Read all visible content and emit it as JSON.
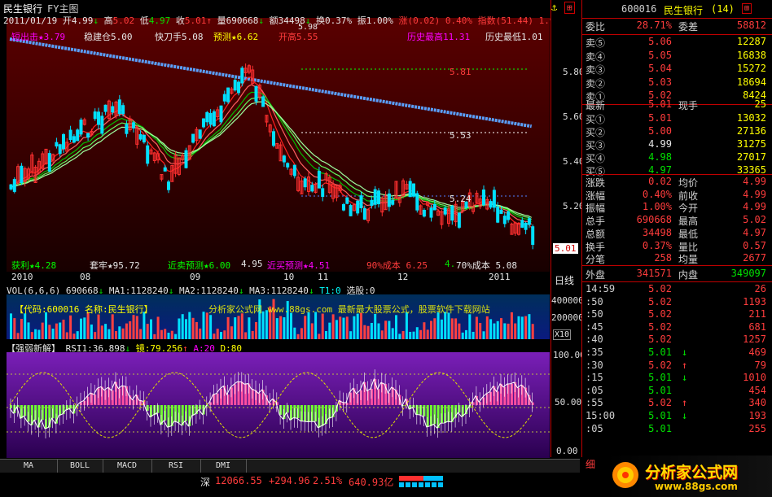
{
  "header": {
    "stock_name": "民生银行",
    "sub_view": "FY主图",
    "date": "2011/01/19",
    "open_label": "开",
    "open": "4.99",
    "high_label": "高",
    "high": "5.02",
    "low_label": "低",
    "low": "4.97",
    "close_label": "收",
    "close": "5.01",
    "volume_label": "量",
    "volume": "690668",
    "amount_label": "额",
    "amount": "34498",
    "turnover_label": "换",
    "turnover": "0.37%",
    "amplitude_label": "振",
    "amplitude": "1.00%",
    "change_label": "涨",
    "change": "(0.02)",
    "change_pct": "0.40%",
    "index_label": "指数",
    "index": "(51.44)",
    "index_pct": "1.90%"
  },
  "main_labels": {
    "top_left": "短出击★3.79",
    "stable": "稳建仓5.00",
    "fast": "快刀手5.08",
    "predict": "预测★6.62",
    "open_price": "开高5.55",
    "high_text": "5.98",
    "hist_high": "历史最高11.31",
    "hist_low": "历史最低1.01",
    "line1": "5.81",
    "line2": "5.53",
    "line3": "5.24",
    "bottom_profit": "获利★4.28",
    "bottom_trap": "套牢★95.72",
    "bottom_near_sell": "近卖预测★6.00",
    "bottom_low": "4.95",
    "bottom_near_buy": "近买预测★4.51",
    "cost90": "90%成本 6.25",
    "cost_num": "4.",
    "cost70": "70%成本 5.08"
  },
  "y_axis_main": [
    "5.80",
    "5.60",
    "5.40",
    "5.20",
    "5.01"
  ],
  "date_axis": [
    "2010",
    "08",
    "09",
    "10",
    "11",
    "12",
    "2011"
  ],
  "timeframe": "日线",
  "volume_header": {
    "name": "VOL(6,6,6)",
    "vol": "690668",
    "ma1": "MA1:1128240",
    "ma2": "MA2:1128240",
    "ma3": "MA3:1128240",
    "t1": "T1:0",
    "select": "选股:0"
  },
  "volume_watermark": "【代码:600016 名称:民生银行】",
  "volume_ad": "分析家公式网 www.88gs.com 最新最大股票公式，股票软件下载网站",
  "volume_axis": [
    "400000",
    "200000",
    "X10"
  ],
  "rsi_header": {
    "name": "【强弱新解】",
    "rsi": "RSI1:36.898",
    "mirror": "镜:79.256",
    "a": "A:20",
    "d": "D:80"
  },
  "rsi_axis": [
    "100.00",
    "50.00",
    "0.00"
  ],
  "tabs": [
    "MA",
    "BOLL",
    "MACD",
    "RSI",
    "DMI"
  ],
  "panel": {
    "code": "600016",
    "name": "民生银行",
    "count": "(14)",
    "weibi_label": "委比",
    "weibi": "28.71%",
    "weicha_label": "委差",
    "weicha": "58812",
    "sells": [
      {
        "label": "卖⑤",
        "price": "5.06",
        "vol": "12287"
      },
      {
        "label": "卖④",
        "price": "5.05",
        "vol": "16838"
      },
      {
        "label": "卖③",
        "price": "5.04",
        "vol": "15272"
      },
      {
        "label": "卖②",
        "price": "5.03",
        "vol": "18694"
      },
      {
        "label": "卖①",
        "price": "5.02",
        "vol": "8424"
      }
    ],
    "latest_label": "最新",
    "latest": "5.01",
    "now_hand_label": "现手",
    "now_hand": "25",
    "buys": [
      {
        "label": "买①",
        "price": "5.01",
        "vol": "13032"
      },
      {
        "label": "买②",
        "price": "5.00",
        "vol": "27136"
      },
      {
        "label": "买③",
        "price": "4.99",
        "vol": "31275"
      },
      {
        "label": "买④",
        "price": "4.98",
        "vol": "27017"
      },
      {
        "label": "买⑤",
        "price": "4.97",
        "vol": "33365"
      }
    ],
    "stats": [
      {
        "l1": "涨跌",
        "v1": "0.02",
        "l2": "均价",
        "v2": "4.99"
      },
      {
        "l1": "涨幅",
        "v1": "0.40%",
        "l2": "前收",
        "v2": "4.99"
      },
      {
        "l1": "振幅",
        "v1": "1.00%",
        "l2": "今开",
        "v2": "4.99"
      },
      {
        "l1": "总手",
        "v1": "690668",
        "l2": "最高",
        "v2": "5.02"
      },
      {
        "l1": "总额",
        "v1": "34498",
        "l2": "最低",
        "v2": "4.97"
      },
      {
        "l1": "换手",
        "v1": "0.37%",
        "l2": "量比",
        "v2": "0.57"
      },
      {
        "l1": "分笔",
        "v1": "258",
        "l2": "均量",
        "v2": "2677"
      }
    ],
    "outer_label": "外盘",
    "outer": "341571",
    "inner_label": "内盘",
    "inner": "349097",
    "ticks": [
      {
        "t": "14:59",
        "p": "5.02",
        "v": "26",
        "a": ""
      },
      {
        "t": ":50",
        "p": "5.02",
        "v": "1193",
        "a": ""
      },
      {
        "t": ":50",
        "p": "5.02",
        "v": "211",
        "a": ""
      },
      {
        "t": ":45",
        "p": "5.02",
        "v": "681",
        "a": ""
      },
      {
        "t": ":40",
        "p": "5.02",
        "v": "1257",
        "a": ""
      },
      {
        "t": ":35",
        "p": "5.01",
        "v": "469",
        "a": "↓"
      },
      {
        "t": ":30",
        "p": "5.02",
        "v": "79",
        "a": "↑"
      },
      {
        "t": ":15",
        "p": "5.01",
        "v": "1010",
        "a": "↓"
      },
      {
        "t": ":05",
        "p": "5.01",
        "v": "454",
        "a": ""
      },
      {
        "t": ":55",
        "p": "5.02",
        "v": "340",
        "a": "↑"
      },
      {
        "t": "15:00",
        "p": "5.01",
        "v": "193",
        "a": "↓"
      },
      {
        "t": ":05",
        "p": "5.01",
        "v": "255",
        "a": ""
      }
    ],
    "detail_label": "细"
  },
  "status": {
    "market": "深",
    "index": "12066.55",
    "change": "+294.96",
    "pct": "2.51%",
    "amount": "640.93亿"
  },
  "logo_text": "分析家公式网",
  "logo_url": "www.88gs.com"
}
